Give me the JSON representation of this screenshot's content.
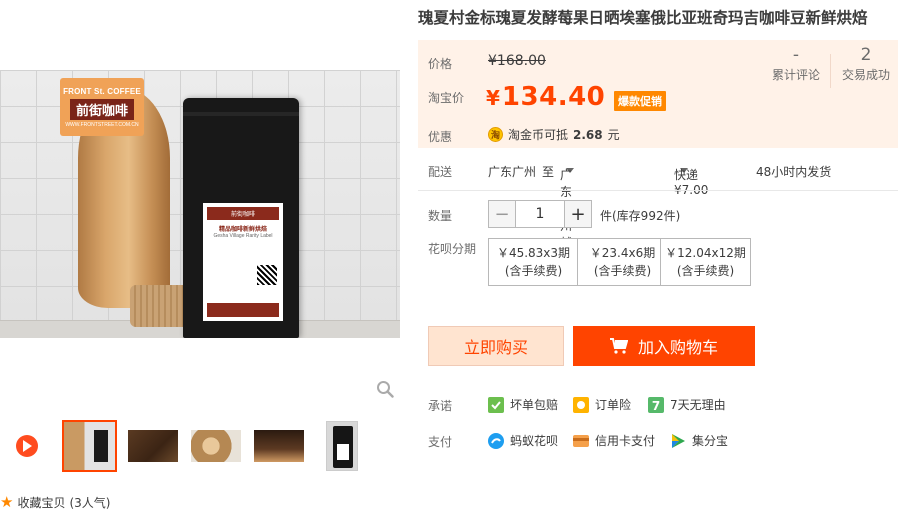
{
  "product": {
    "title": "瑰夏村金标瑰夏发酵莓果日晒埃塞俄比亚班奇玛吉咖啡豆新鲜烘焙"
  },
  "gallery": {
    "brand_card_line1": "FRONT St. COFFEE",
    "brand_card_line2": "前街咖啡",
    "brand_card_line3": "WWW.FRONTSTREET.COM.CN",
    "bag_label_top": "前街咖啡",
    "bag_label_name": "精品咖啡新鲜烘焙",
    "bag_label_sub": "Gesha Village Rarity Label",
    "thumbnail_count": 5
  },
  "price": {
    "price_label": "价格",
    "original_price": "¥168.00",
    "taobao_label": "淘宝价",
    "currency": "¥",
    "current_price": "134.40",
    "promo_badge": "爆款促销",
    "reviews_value": "-",
    "reviews_label": "累计评论",
    "deals_value": "2",
    "deals_label": "交易成功",
    "discount_label": "优惠",
    "coin_text_prefix": "淘金币可抵",
    "coin_amount": "2.68",
    "coin_text_suffix": "元"
  },
  "shipping": {
    "label": "配送",
    "from": "广东广州",
    "to_word": "至",
    "to": "广东广州越秀区",
    "method": "快递 ¥7.00",
    "dispatch": "48小时内发货"
  },
  "quantity": {
    "label": "数量",
    "minus": "−",
    "value": "1",
    "plus": "+",
    "stock": "件(库存992件)"
  },
  "installments": {
    "label": "花呗分期",
    "options": [
      {
        "amount": "￥45.83x3期",
        "note": "(含手续费)"
      },
      {
        "amount": "￥23.4x6期",
        "note": "(含手续费)"
      },
      {
        "amount": "￥12.04x12期",
        "note": "(含手续费)"
      }
    ]
  },
  "actions": {
    "buy_now": "立即购买",
    "add_to_cart": "加入购物车"
  },
  "promises": {
    "label": "承诺",
    "items": [
      "坏单包赔",
      "订单险",
      "7天无理由"
    ]
  },
  "payment": {
    "label": "支付",
    "items": [
      "蚂蚁花呗",
      "信用卡支付",
      "集分宝"
    ]
  },
  "favorite": {
    "label": "收藏宝贝",
    "popularity": "(3人气)"
  },
  "colors": {
    "accent": "#ff4400",
    "price_bg": "#fff2e8",
    "promo": "#ff8800"
  }
}
